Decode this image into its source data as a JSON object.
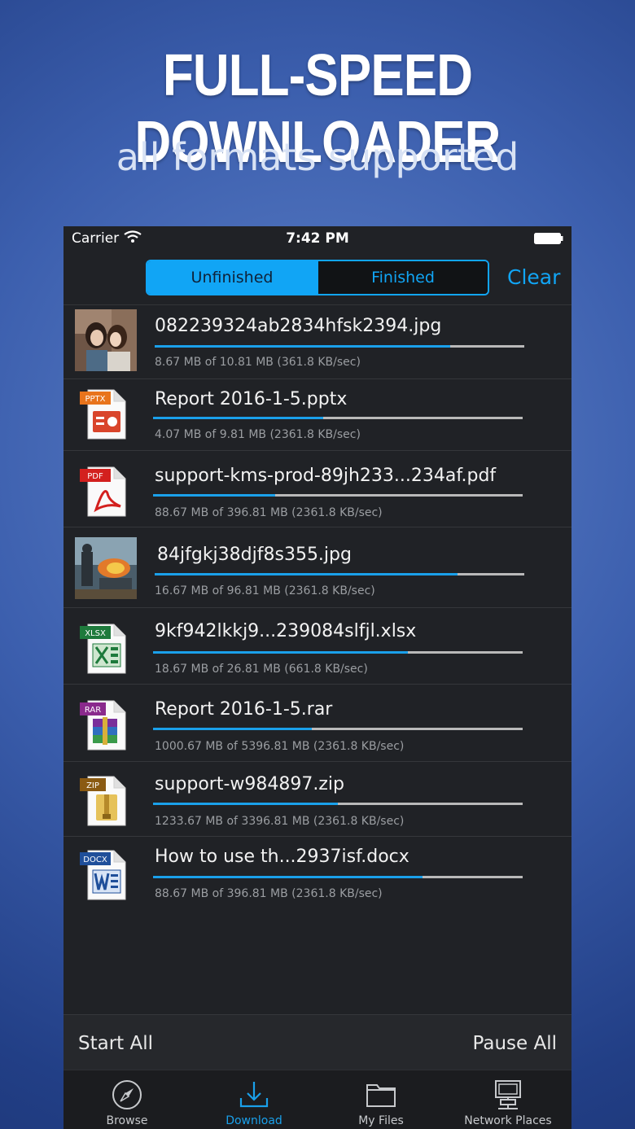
{
  "promo": {
    "headline": "FULL-SPEED DOWNLOADER",
    "subheadline": "all formats supported"
  },
  "status_bar": {
    "carrier": "Carrier",
    "time": "7:42 PM"
  },
  "header": {
    "segments": [
      "Unfinished",
      "Finished"
    ],
    "selected_segment": "Unfinished",
    "clear_label": "Clear"
  },
  "downloads": [
    {
      "name": "082239324ab2834hfsk2394.jpg",
      "progress_text": "8.67 MB of 10.81 MB (361.8 KB/sec)",
      "progress": 0.8,
      "icon": "image-thumbnail-anime"
    },
    {
      "name": "Report 2016-1-5.pptx",
      "progress_text": "4.07 MB of 9.81 MB (2361.8 KB/sec)",
      "progress": 0.46,
      "icon": "pptx-file-icon",
      "badge": "PPTX"
    },
    {
      "name": "support-kms-prod-89jh233...234af.pdf",
      "progress_text": "88.67 MB of 396.81 MB (2361.8 KB/sec)",
      "progress": 0.33,
      "icon": "pdf-file-icon",
      "badge": "PDF"
    },
    {
      "name": "84jfgkj38djf8s355.jpg",
      "progress_text": "16.67 MB of 96.81 MB (2361.8 KB/sec)",
      "progress": 0.82,
      "icon": "image-thumbnail-battle"
    },
    {
      "name": "9kf942lkkj9...239084slfjl.xlsx",
      "progress_text": "18.67 MB of 26.81 MB (661.8 KB/sec)",
      "progress": 0.69,
      "icon": "xlsx-file-icon",
      "badge": "XLSX"
    },
    {
      "name": "Report 2016-1-5.rar",
      "progress_text": "1000.67 MB of 5396.81 MB (2361.8 KB/sec)",
      "progress": 0.43,
      "icon": "rar-file-icon",
      "badge": "RAR"
    },
    {
      "name": "support-w984897.zip",
      "progress_text": "1233.67 MB of 3396.81 MB (2361.8 KB/sec)",
      "progress": 0.5,
      "icon": "zip-file-icon",
      "badge": "ZIP"
    },
    {
      "name": "How to use th...2937isf.docx",
      "progress_text": "88.67 MB of 396.81 MB (2361.8 KB/sec)",
      "progress": 0.73,
      "icon": "docx-file-icon",
      "badge": "DOCX"
    }
  ],
  "actions": {
    "start_all": "Start All",
    "pause_all": "Pause All"
  },
  "tabs": [
    {
      "label": "Browse",
      "icon": "compass-icon"
    },
    {
      "label": "Download",
      "icon": "download-icon"
    },
    {
      "label": "My Files",
      "icon": "folder-icon"
    },
    {
      "label": "Network Places",
      "icon": "network-computer-icon"
    }
  ],
  "active_tab": "Download",
  "colors": {
    "accent": "#1aa0ea",
    "background": "#202226"
  }
}
